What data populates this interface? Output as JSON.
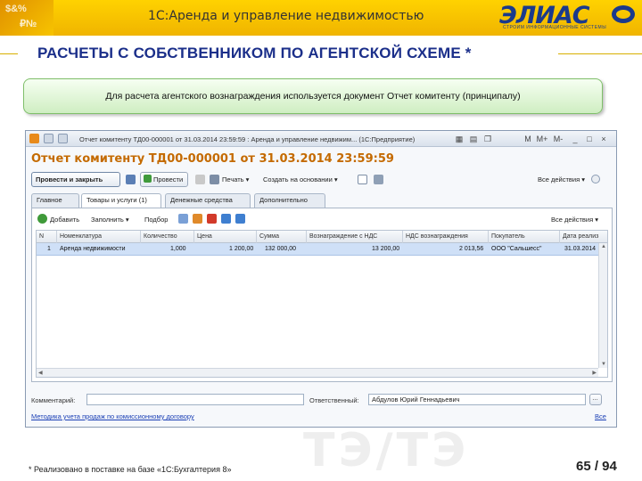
{
  "slide": {
    "app_title": "1С:Аренда и управление недвижимостью",
    "logo_text": "ЭЛИАС",
    "logo_subtitle": "СТРОИМ ИНФОРМАЦИОННЫЕ СИСТЕМЫ",
    "corner_deco": [
      "$&%",
      "₽№"
    ],
    "heading": "РАСЧЕТЫ С СОБСТВЕННИКОМ ПО АГЕНТСКОЙ СХЕМЕ *",
    "note": "Для расчета агентского вознаграждения используется документ Отчет комитенту (принципалу)",
    "watermark": "ТЭ/ТЭ",
    "footnote": "* Реализовано в поставке на базе «1С:Бухгалтерия 8»",
    "page": "65 / 94"
  },
  "window": {
    "titlebar_text": "Отчет комитенту ТД00-000001 от 31.03.2014 23:59:59 : Аренда и управление недвижим... (1С:Предприятие)",
    "titlebar_buttons": [
      "M",
      "M+",
      "M-",
      "_",
      "□",
      "×"
    ],
    "doc_title": "Отчет комитенту ТД00-000001 от 31.03.2014 23:59:59",
    "toolbar": {
      "post_close": "Провести и закрыть",
      "post": "Провести",
      "print": "Печать ▾",
      "create_based_on": "Создать на основании ▾",
      "actions": "Все действия ▾"
    },
    "tabs": [
      "Главное",
      "Товары и услуги (1)",
      "Денежные средства",
      "Дополнительно"
    ],
    "table_toolbar": {
      "add": "Добавить",
      "fill": "Заполнить ▾",
      "select": "Подбор",
      "actions": "Все действия ▾"
    },
    "columns": [
      "N",
      "Номенклатура",
      "Количество",
      "Цена",
      "Сумма",
      "Вознаграждение с НДС",
      "НДС вознаграждения",
      "Покупатель",
      "Дата реализ"
    ],
    "rows": [
      {
        "n": "1",
        "item": "Аренда недвижимости",
        "qty": "1,000",
        "price": "1 200,00",
        "sum": "132 000,00",
        "fee_vat": "13 200,00",
        "vat": "2 013,56",
        "buyer": "ООО \"Сальшесс\"",
        "date": "31.03.2014"
      }
    ],
    "comment_label": "Комментарий:",
    "comment_value": "",
    "responsible_label": "Ответственный:",
    "responsible_value": "Абдулов Юрий Геннадьевич",
    "link_text": "Методика учета продаж по комиссионному договору",
    "all_link": "Все"
  },
  "colors": {
    "header_yellow": "#ffd200",
    "heading_blue": "#1b2f8a",
    "doc_title_orange": "#c46a00",
    "row_selected": "#cfe0f7",
    "note_green": "#cfeec2"
  }
}
